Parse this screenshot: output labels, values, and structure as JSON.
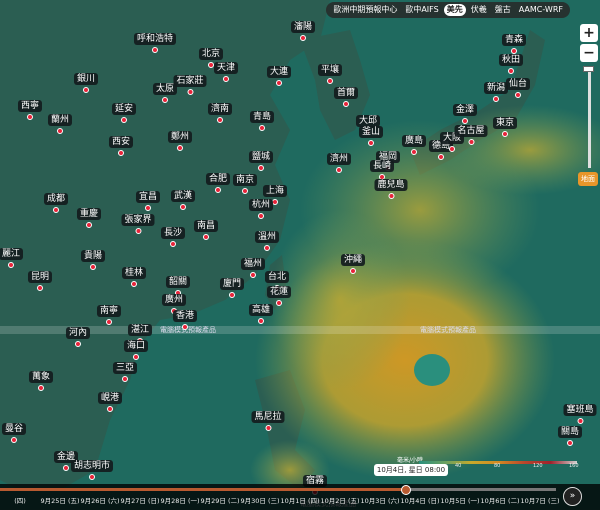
{
  "menu": {
    "items": [
      {
        "label": "歐洲中期預報中心",
        "active": false
      },
      {
        "label": "歐中AIFS",
        "active": false
      },
      {
        "label": "美先",
        "active": true
      },
      {
        "label": "伏羲",
        "active": false
      },
      {
        "label": "盤古",
        "active": false
      },
      {
        "label": "AAMC-WRF",
        "active": false
      }
    ]
  },
  "controls": {
    "zoom_in": "+",
    "zoom_out": "−",
    "layer_button": "地面"
  },
  "map": {
    "banner_text": "電腦模式預報產品",
    "colors": {
      "ocean": "#1f6a5f",
      "land": "#2a5c4e",
      "rain_moderate": "#c7a92b",
      "rain_heavy": "#d38a22",
      "city_dot": "#e8243a"
    },
    "cities": [
      {
        "name": "呼和浩特"
      },
      {
        "name": "北京"
      },
      {
        "name": "天津"
      },
      {
        "name": "太原"
      },
      {
        "name": "石家莊"
      },
      {
        "name": "銀川"
      },
      {
        "name": "西寧"
      },
      {
        "name": "蘭州"
      },
      {
        "name": "延安"
      },
      {
        "name": "濟南"
      },
      {
        "name": "鄭州"
      },
      {
        "name": "西安"
      },
      {
        "name": "青島"
      },
      {
        "name": "大連"
      },
      {
        "name": "瀋陽"
      },
      {
        "name": "平壤"
      },
      {
        "name": "首爾"
      },
      {
        "name": "大邱"
      },
      {
        "name": "釜山"
      },
      {
        "name": "濟州"
      },
      {
        "name": "福岡"
      },
      {
        "name": "長崎"
      },
      {
        "name": "鹿兒島"
      },
      {
        "name": "廣島"
      },
      {
        "name": "德島"
      },
      {
        "name": "大阪"
      },
      {
        "name": "名古屋"
      },
      {
        "name": "東京"
      },
      {
        "name": "金澤"
      },
      {
        "name": "新潟"
      },
      {
        "name": "仙台"
      },
      {
        "name": "秋田"
      },
      {
        "name": "青森"
      },
      {
        "name": "鹽城"
      },
      {
        "name": "合肥"
      },
      {
        "name": "南京"
      },
      {
        "name": "上海"
      },
      {
        "name": "杭州"
      },
      {
        "name": "成都"
      },
      {
        "name": "宜昌"
      },
      {
        "name": "武漢"
      },
      {
        "name": "重慶"
      },
      {
        "name": "張家界"
      },
      {
        "name": "長沙"
      },
      {
        "name": "南昌"
      },
      {
        "name": "溫州"
      },
      {
        "name": "福州"
      },
      {
        "name": "台北"
      },
      {
        "name": "花蓮"
      },
      {
        "name": "廈門"
      },
      {
        "name": "韶關"
      },
      {
        "name": "廣州"
      },
      {
        "name": "香港"
      },
      {
        "name": "高雄"
      },
      {
        "name": "沖繩"
      },
      {
        "name": "麗江"
      },
      {
        "name": "昆明"
      },
      {
        "name": "貴陽"
      },
      {
        "name": "桂林"
      },
      {
        "name": "南寧"
      },
      {
        "name": "湛江"
      },
      {
        "name": "海口"
      },
      {
        "name": "河內"
      },
      {
        "name": "三亞"
      },
      {
        "name": "萬象"
      },
      {
        "name": "峴港"
      },
      {
        "name": "曼谷"
      },
      {
        "name": "金邊"
      },
      {
        "name": "胡志明市"
      },
      {
        "name": "馬尼拉"
      },
      {
        "name": "宿霧"
      },
      {
        "name": "塞班島"
      },
      {
        "name": "關島"
      }
    ]
  },
  "legend": {
    "title": "毫米/小時",
    "ticks": [
      "40",
      "80",
      "120",
      "160"
    ]
  },
  "timeline": {
    "tooltip": "10月4日, 星日 08:00",
    "progress": 0.73,
    "dates": [
      "(四)",
      "9月25日 (五)",
      "9月26日 (六)",
      "9月27日 (日)",
      "9月28日 (一)",
      "9月29日 (二)",
      "9月30日 (三)",
      "10月1日 (四)",
      "10月2日 (五)",
      "10月3日 (六)",
      "10月4日 (日)",
      "10月5日 (一)",
      "10月6日 (二)",
      "10月7日 (三)"
    ],
    "play": "»"
  }
}
